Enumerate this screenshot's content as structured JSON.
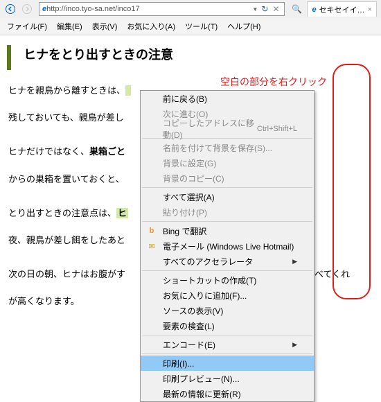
{
  "nav": {
    "url": "http://inco.tyo-sa.net/inco17",
    "tab_title": "セキセイイ…"
  },
  "menubar": [
    "ファイル(F)",
    "編集(E)",
    "表示(V)",
    "お気に入り(A)",
    "ツール(T)",
    "ヘルプ(H)"
  ],
  "page": {
    "title": "ヒナをとり出すときの注意",
    "lines": [
      "ヒナを親鳥から離すときは、",
      "残しておいても、親鳥が差し",
      "ヒナだけではなく、巣箱ごと",
      "からの巣箱を置いておくと、",
      "とり出すときの注意点は、ヒ",
      "夜、親鳥が差し餌をしたあと",
      "次の日の朝、ヒナはお腹がす　　　　　　　　　　　　　　　　　　　を食べてくれ",
      "が高くなります。"
    ]
  },
  "annotation": "空白の部分を右クリック",
  "context_menu": {
    "back": "前に戻る(B)",
    "forward": "次に進む(O)",
    "goto_copied": "コピーしたアドレスに移動(D)",
    "goto_copied_hint": "Ctrl+Shift+L",
    "save_bg": "名前を付けて背景を保存(S)...",
    "set_bg": "背景に設定(G)",
    "copy_bg": "背景のコピー(C)",
    "select_all": "すべて選択(A)",
    "paste": "貼り付け(P)",
    "bing": "Bing で翻訳",
    "mail": "電子メール (Windows Live Hotmail)",
    "accel": "すべてのアクセラレータ",
    "shortcut": "ショートカットの作成(T)",
    "add_fav": "お気に入りに追加(F)...",
    "view_src": "ソースの表示(V)",
    "inspect": "要素の検査(L)",
    "encoding": "エンコード(E)",
    "print": "印刷(I)...",
    "print_preview": "印刷プレビュー(N)...",
    "refresh": "最新の情報に更新(R)"
  }
}
